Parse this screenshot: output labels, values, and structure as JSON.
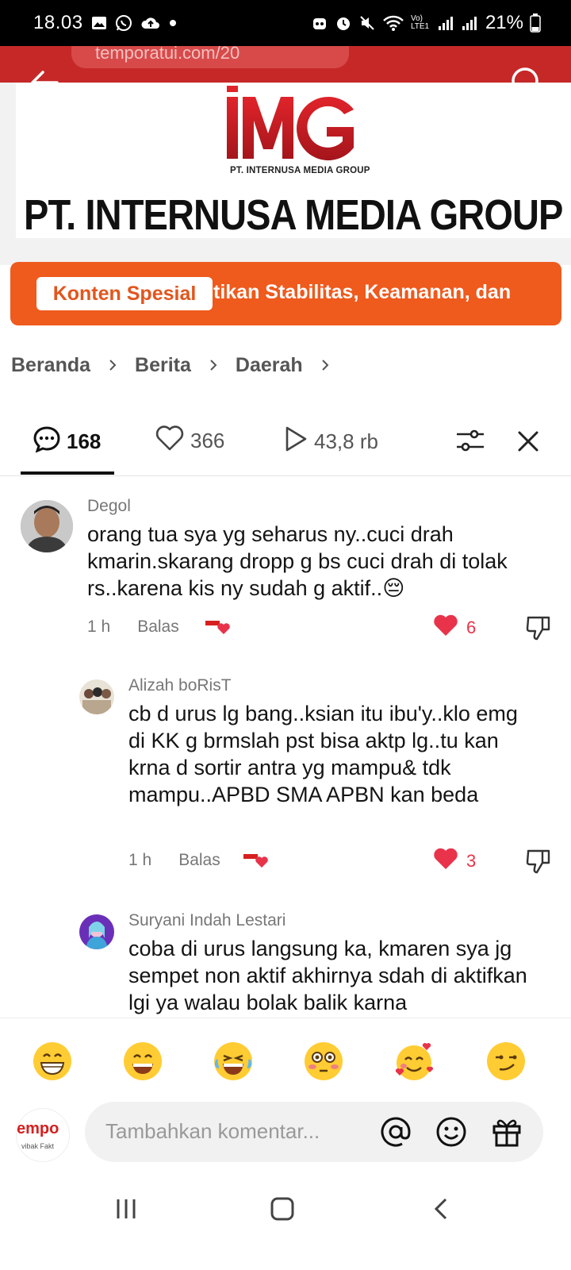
{
  "status_bar": {
    "time": "18.03",
    "battery": "21%",
    "network": "Vo) LTE1"
  },
  "browser": {
    "url": "temporatui.com/20"
  },
  "banner": {
    "logo_sub": "PT. INTERNUSA MEDIA GROUP",
    "company_name": "PT. INTERNUSA MEDIA GROUP"
  },
  "special": {
    "badge": "Konten Spesial",
    "text": "tikan Stabilitas, Keamanan, dan"
  },
  "breadcrumb": {
    "items": [
      "Beranda",
      "Berita",
      "Daerah"
    ]
  },
  "tabs": {
    "comments": "168",
    "likes": "366",
    "views": "43,8 rb"
  },
  "comments": [
    {
      "name": "Degol",
      "text": "orang tua sya yg seharus ny..cuci drah kmarin.skarang dropp g bs cuci drah di tolak rs..karena kis ny sudah g aktif..",
      "emoji": "😔",
      "time": "1 h",
      "reply": "Balas",
      "likes": "6"
    },
    {
      "name": "Alizah boRisT",
      "text": "cb d urus lg bang..ksian itu ibu'y..klo emg di KK g brmslah pst bisa aktp lg..tu kan krna d sortir antra yg mampu& tdk mampu..APBD SMA APBN kan beda",
      "time": "1 h",
      "reply": "Balas",
      "likes": "3"
    },
    {
      "name": "Suryani Indah Lestari",
      "text": "coba di urus langsung ka, kmaren sya jg sempet non aktif akhirnya sdah di aktifkan lgi ya walau bolak balik karna"
    }
  ],
  "emojis": [
    "😁",
    "😄",
    "😂",
    "😳",
    "🥰",
    "😏"
  ],
  "input": {
    "placeholder": "Tambahkan komentar...",
    "me_logo": "empo",
    "me_tagline": "vibak Fakt"
  },
  "colors": {
    "accent_red": "#c62828",
    "special_orange": "#ef5a1d",
    "like_red": "#e8334a"
  }
}
